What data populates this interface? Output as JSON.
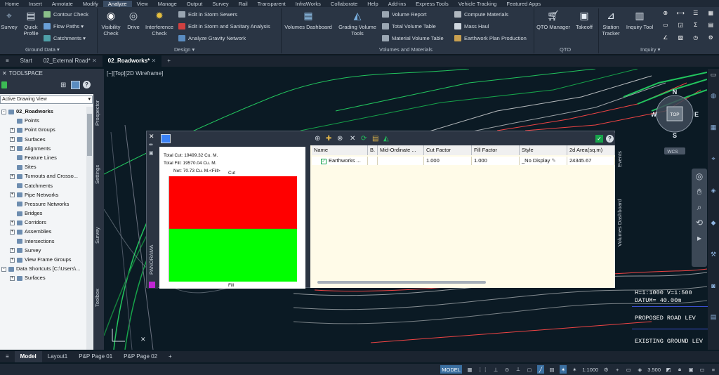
{
  "menu": [
    "Home",
    "Insert",
    "Annotate",
    "Modify",
    "Analyze",
    "View",
    "Manage",
    "Output",
    "Survey",
    "Rail",
    "Transparent",
    "InfraWorks",
    "Collaborate",
    "Help",
    "Add-ins",
    "Express Tools",
    "Vehicle Tracking",
    "Featured Apps"
  ],
  "menu_active": "Analyze",
  "ribbon": {
    "ground_data": {
      "label": "Ground Data",
      "survey": "Survey",
      "quick_profile": "Quick Profile",
      "contour_check": "Contour Check",
      "flow_paths": "Flow Paths",
      "catchments": "Catchments"
    },
    "design": {
      "label": "Design",
      "visibility_check": "Visibility Check",
      "drive": "Drive",
      "interference_check": "Interference Check",
      "edit_storm": "Edit in Storm Sewers",
      "edit_storm_sanitary": "Edit in Storm and Sanitary Analysis",
      "analyze_gravity": "Analyze Gravity Network"
    },
    "volumes": {
      "label": "Volumes and Materials",
      "volumes_dashboard": "Volumes Dashboard",
      "grading_volume_tools": "Grading Volume Tools",
      "volume_report": "Volume Report",
      "total_volume_table": "Total Volume Table",
      "material_volume_table": "Material Volume Table",
      "compute_materials": "Compute Materials",
      "mass_haul": "Mass Haul",
      "earthwork_plan": "Earthwork Plan Production"
    },
    "qto": {
      "label": "QTO",
      "qto_manager": "QTO Manager",
      "takeoff": "Takeoff"
    },
    "inquiry": {
      "label": "Inquiry",
      "station_tracker": "Station Tracker",
      "inquiry_tool": "Inquiry Tool"
    }
  },
  "file_tabs": [
    "Start",
    "02_External Road*",
    "02_Roadworks*"
  ],
  "file_tab_active": "02_Roadworks*",
  "toolspace": {
    "title": "TOOLSPACE",
    "view_combo": "Active Drawing View",
    "tree": [
      {
        "label": "02_Roadworks",
        "level": 0,
        "expand": "-",
        "bold": true
      },
      {
        "label": "Points",
        "level": 1,
        "expand": ""
      },
      {
        "label": "Point Groups",
        "level": 1,
        "expand": "+"
      },
      {
        "label": "Surfaces",
        "level": 1,
        "expand": "+"
      },
      {
        "label": "Alignments",
        "level": 1,
        "expand": "+"
      },
      {
        "label": "Feature Lines",
        "level": 1,
        "expand": ""
      },
      {
        "label": "Sites",
        "level": 1,
        "expand": ""
      },
      {
        "label": "Turnouts and Crosso...",
        "level": 1,
        "expand": "+"
      },
      {
        "label": "Catchments",
        "level": 1,
        "expand": ""
      },
      {
        "label": "Pipe Networks",
        "level": 1,
        "expand": "+"
      },
      {
        "label": "Pressure Networks",
        "level": 1,
        "expand": ""
      },
      {
        "label": "Bridges",
        "level": 1,
        "expand": ""
      },
      {
        "label": "Corridors",
        "level": 1,
        "expand": "+"
      },
      {
        "label": "Assemblies",
        "level": 1,
        "expand": "+"
      },
      {
        "label": "Intersections",
        "level": 1,
        "expand": ""
      },
      {
        "label": "Survey",
        "level": 1,
        "expand": "+"
      },
      {
        "label": "View Frame Groups",
        "level": 1,
        "expand": "+"
      },
      {
        "label": "Data Shortcuts [C:\\Users\\...",
        "level": 0,
        "expand": "-"
      },
      {
        "label": "Surfaces",
        "level": 1,
        "expand": "+"
      }
    ],
    "side_tabs": [
      "Prospector",
      "Settings",
      "Survey",
      "Toolbox"
    ]
  },
  "viewport_label": "[−][Top][2D Wireframe]",
  "viewcube": {
    "top": "TOP",
    "n": "N",
    "s": "S",
    "e": "E",
    "w": "W",
    "wcs": "WCS"
  },
  "annotations": {
    "scale": "H=1:1000  V=1:500",
    "datum": "DATUM= 40.00m",
    "proposed": "PROPOSED ROAD LEV",
    "existing": "EXISTING GROUND LEV"
  },
  "panorama": {
    "title": "PANORAMA",
    "side_tabs": [
      "Events",
      "Volumes Dashboard"
    ],
    "total_cut": "Total Cut: 19499.32 Cu. M.",
    "total_fill": "Total Fill: 19570.04 Cu. M.",
    "net": "Net: 70.73 Cu. M.<Fill>",
    "cut_label": "Cut",
    "fill_label": "Fill",
    "columns": [
      "Name",
      "B.",
      "Mid-Ordinate ...",
      "Cut Factor",
      "Fill Factor",
      "Style",
      "2d Area(sq.m)"
    ],
    "rows": [
      {
        "name": "Earthworks ...",
        "b": "",
        "mid": "",
        "cut_factor": "1.000",
        "fill_factor": "1.000",
        "style": "_No Display",
        "area": "24345.67"
      }
    ]
  },
  "chart_data": {
    "type": "bar",
    "categories": [
      "Cut",
      "Fill"
    ],
    "values": [
      19499.32,
      19570.04
    ],
    "colors": [
      "#ff0000",
      "#00ff00"
    ],
    "title": "",
    "xlabel": "",
    "ylabel": ""
  },
  "layout_tabs": [
    "Model",
    "Layout1",
    "P&P Page 01",
    "P&P Page 02"
  ],
  "layout_active": "Model",
  "status": {
    "model": "MODEL",
    "scale": "1:1000",
    "value": "3.500"
  }
}
